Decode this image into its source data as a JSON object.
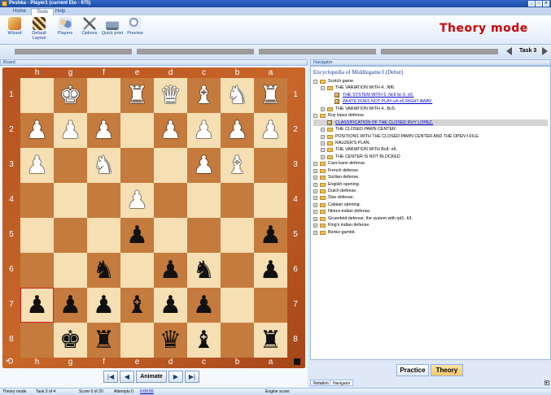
{
  "window": {
    "title": "Peshka - Player1 (current Elo - 975)"
  },
  "ribbon": {
    "tabs": [
      "Home",
      "Tools",
      "Help"
    ],
    "active_tab": "Tools",
    "buttons": [
      {
        "label": "Wizard",
        "icon": "wand-icon",
        "color": "#c96a1b"
      },
      {
        "label": "Default Layout",
        "icon": "layout-icon",
        "color": "#d89b2a"
      },
      {
        "label": "Players",
        "icon": "players-icon",
        "color": "#6a8fcc"
      },
      {
        "label": "Options",
        "icon": "tools-icon",
        "color": "#7d7d7d"
      },
      {
        "label": "Quick print",
        "icon": "printer-icon",
        "color": "#8aa0bd"
      },
      {
        "label": "Preview",
        "icon": "magnifier-icon",
        "color": "#b9c9e3"
      }
    ],
    "mode_label": "Theory mode"
  },
  "taskbar": {
    "task_label": "Task 3"
  },
  "board_panel": {
    "title": "Board"
  },
  "board": {
    "files": [
      "h",
      "g",
      "f",
      "e",
      "d",
      "c",
      "b",
      "a"
    ],
    "ranks": [
      "1",
      "2",
      "3",
      "4",
      "5",
      "6",
      "7",
      "8"
    ],
    "highlight": {
      "row": 6,
      "col": 0
    },
    "rows": [
      [
        "",
        "wK",
        "",
        "wR",
        "wQ",
        "wB",
        "wN",
        "wR"
      ],
      [
        "wP",
        "wP",
        "wP",
        "",
        "wP",
        "wP",
        "wP",
        "wP"
      ],
      [
        "wP",
        "",
        "wN",
        "",
        "",
        "wP",
        "wB",
        ""
      ],
      [
        "",
        "",
        "",
        "wP",
        "",
        "",
        "",
        ""
      ],
      [
        "",
        "",
        "",
        "bP",
        "",
        "",
        "",
        "bP"
      ],
      [
        "",
        "",
        "bN",
        "",
        "bP",
        "bN",
        "",
        "bP"
      ],
      [
        "bP",
        "bP",
        "bP",
        "bB",
        "bP",
        "bP",
        "",
        ""
      ],
      [
        "",
        "bK",
        "bR",
        "",
        "bQ",
        "bB",
        "",
        "bR"
      ]
    ]
  },
  "controls": {
    "animate_label": "Animate"
  },
  "navigator": {
    "panel_title": "Navigator",
    "book_title": "Encyclopedia of Middlegame I (Debut)",
    "tree": [
      {
        "level": 0,
        "label": "Scotch game.",
        "type": "folder",
        "expanded": true
      },
      {
        "level": 1,
        "label": "THE VARIATION WITH 4...Nf6.",
        "type": "folder",
        "expanded": true
      },
      {
        "level": 2,
        "label": "THE SYSTEM WITH 5. Nc6 bc 6. e5.",
        "type": "link"
      },
      {
        "level": 2,
        "label": "WHITE DOES NOT PLAY e4-e5 RIGHT AWAY.",
        "type": "link"
      },
      {
        "level": 1,
        "label": "THE VARIATION WITH 4...Bc5.",
        "type": "folder",
        "expanded": false
      },
      {
        "level": 0,
        "label": "Ruy lopez defense.",
        "type": "folder",
        "expanded": true
      },
      {
        "level": 1,
        "label": "CLASSIFICATION OF THE CLOSED RUY LOPEZ.",
        "type": "link",
        "selected": true
      },
      {
        "level": 1,
        "label": "THE CLOSED PAWN CENTER.",
        "type": "folder",
        "expanded": false
      },
      {
        "level": 1,
        "label": "POSITIONS WITH THE CLOSED PAWN CENTER AND THE OPEN f-FILE.",
        "type": "folder",
        "expanded": false
      },
      {
        "level": 1,
        "label": "RAUZER'S PLAN.",
        "type": "folder",
        "expanded": false
      },
      {
        "level": 1,
        "label": "THE VARIATION WITH Bc8- e6.",
        "type": "folder",
        "expanded": false
      },
      {
        "level": 1,
        "label": "THE CENTER IS NOT BLOCKED",
        "type": "folder",
        "expanded": false
      },
      {
        "level": 0,
        "label": "Caro-kann defense.",
        "type": "folder",
        "expanded": false
      },
      {
        "level": 0,
        "label": "French defense.",
        "type": "folder",
        "expanded": false
      },
      {
        "level": 0,
        "label": "Sicilian defense.",
        "type": "folder",
        "expanded": false
      },
      {
        "level": 0,
        "label": "English opening.",
        "type": "folder",
        "expanded": false
      },
      {
        "level": 0,
        "label": "Dutch defense.",
        "type": "folder",
        "expanded": false
      },
      {
        "level": 0,
        "label": "Slav defense.",
        "type": "folder",
        "expanded": false
      },
      {
        "level": 0,
        "label": "Catalan opening.",
        "type": "folder",
        "expanded": false
      },
      {
        "level": 0,
        "label": "Nimzo-indian defense.",
        "type": "folder",
        "expanded": false
      },
      {
        "level": 0,
        "label": "Gruenfeld defense, the system with qd1- b3.",
        "type": "folder",
        "expanded": false
      },
      {
        "level": 0,
        "label": "King's indian defense.",
        "type": "folder",
        "expanded": false
      },
      {
        "level": 0,
        "label": "Benko gambit.",
        "type": "folder",
        "expanded": false
      }
    ]
  },
  "modes": {
    "practice": "Practice",
    "theory": "Theory"
  },
  "doc_tabs": {
    "notation": "Notation",
    "navigator": "Navigator"
  },
  "status": {
    "mode": "Theory mode",
    "task": "Task 3 of 4",
    "score": "Score 0 of 20",
    "attempts": "Attempts 0",
    "time": "0:00:55",
    "engine": "Engine score:"
  },
  "colors": {
    "light_square": "#f5dfb3",
    "dark_square": "#c57b3d",
    "frame": "#b5521f",
    "mode_text": "#cc0000",
    "theory_active": "#f7c76a"
  }
}
